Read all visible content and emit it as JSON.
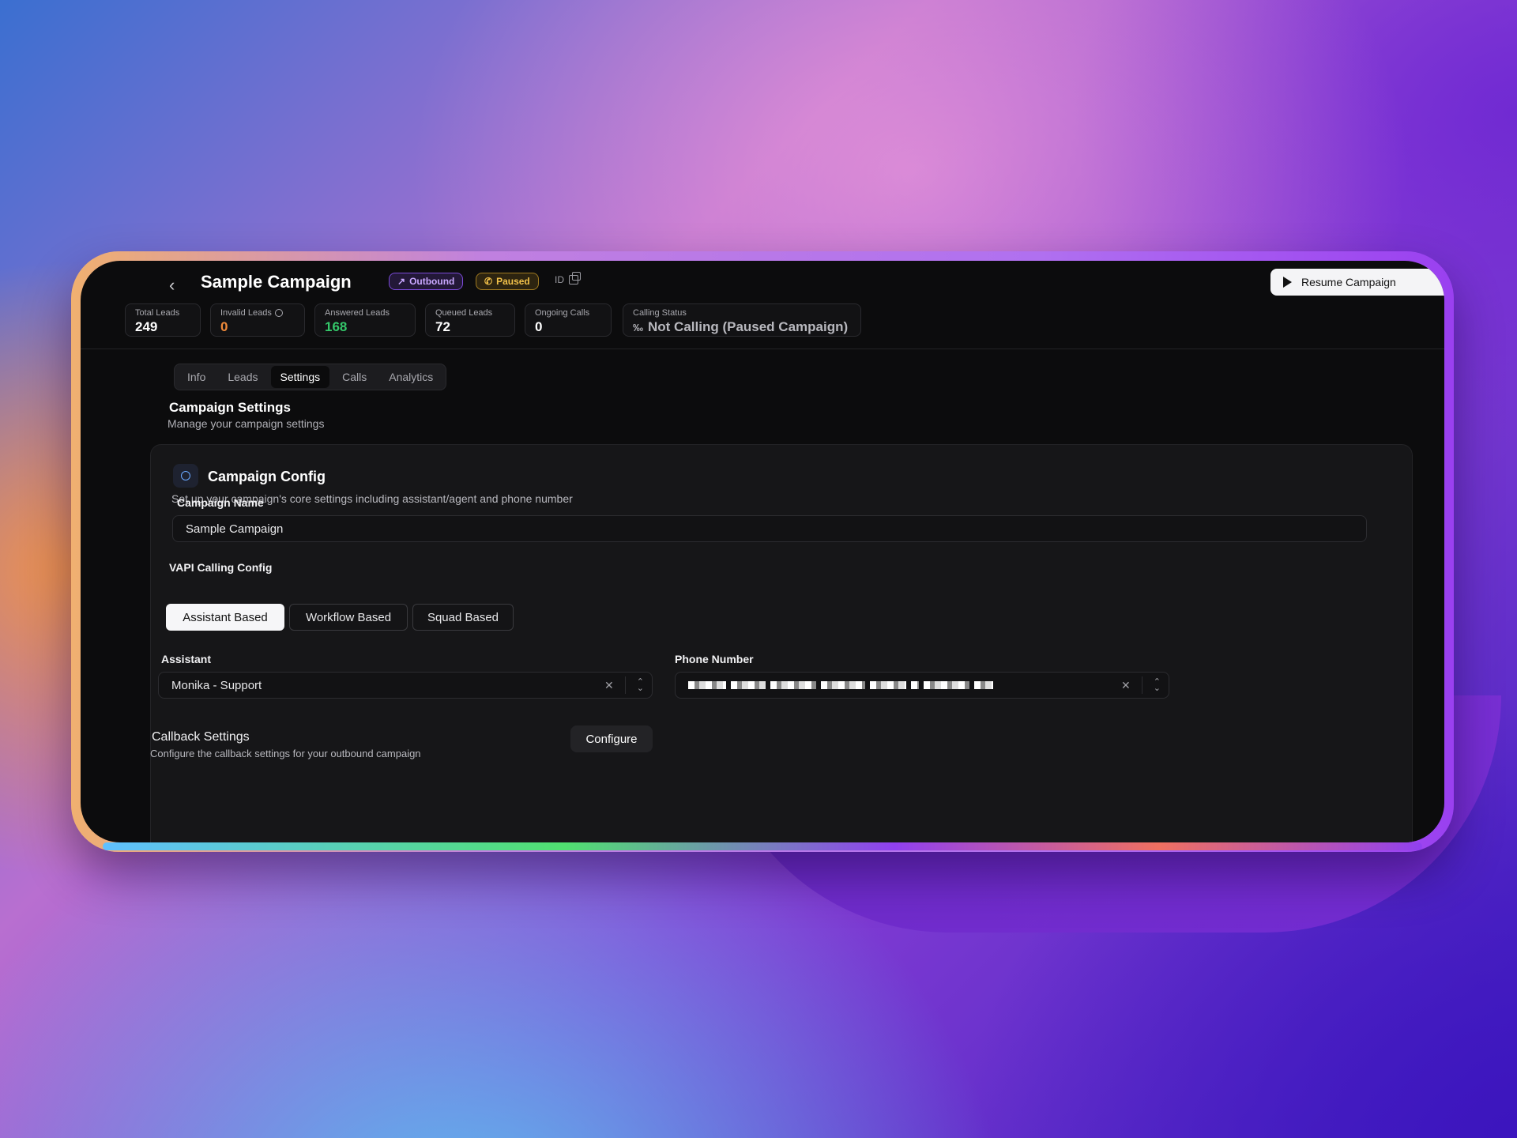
{
  "header": {
    "back_icon": "chevron-left-icon",
    "title": "Sample Campaign",
    "badge_outbound": "Outbound",
    "badge_paused": "Paused",
    "id_label": "ID",
    "resume_label": "Resume Campaign"
  },
  "stats": [
    {
      "label": "Total Leads",
      "value": "249",
      "color": "#ffffff"
    },
    {
      "label": "Invalid Leads",
      "value": "0",
      "color": "#f08a3a"
    },
    {
      "label": "Answered Leads",
      "value": "168",
      "color": "#34c76a"
    },
    {
      "label": "Queued Leads",
      "value": "72",
      "color": "#ffffff"
    },
    {
      "label": "Ongoing Calls",
      "value": "0",
      "color": "#ffffff"
    },
    {
      "label": "Calling Status",
      "value": "Not Calling (Paused Campaign)",
      "color": "#b8b8be"
    }
  ],
  "tabs": [
    {
      "label": "Info",
      "active": false
    },
    {
      "label": "Leads",
      "active": false
    },
    {
      "label": "Settings",
      "active": true
    },
    {
      "label": "Calls",
      "active": false
    },
    {
      "label": "Analytics",
      "active": false
    }
  ],
  "section": {
    "title": "Campaign Settings",
    "subtitle": "Manage your campaign settings"
  },
  "config": {
    "title": "Campaign Config",
    "subtitle": "Set up your campaign's core settings including assistant/agent and phone number",
    "campaign_name_label": "Campaign Name",
    "campaign_name_value": "Sample Campaign",
    "vapi_label": "VAPI Calling Config",
    "modes": [
      "Assistant Based",
      "Workflow Based",
      "Squad Based"
    ],
    "assistant_label": "Assistant",
    "assistant_value": "Monika - Support",
    "phone_label": "Phone Number",
    "callback_title": "Callback Settings",
    "callback_subtitle": "Configure the callback settings for your outbound campaign",
    "configure_label": "Configure"
  }
}
